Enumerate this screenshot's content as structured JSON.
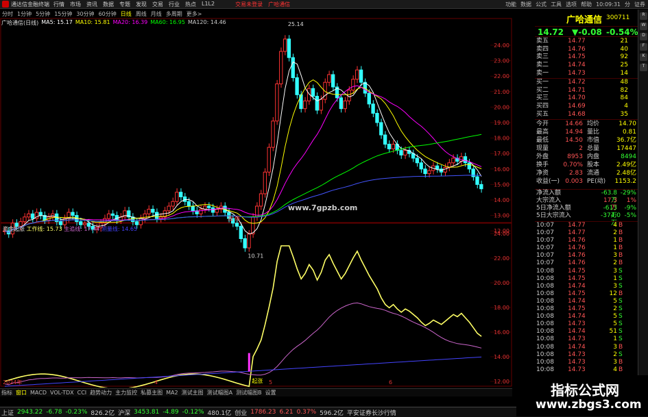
{
  "window": {
    "app_title": "通达信金融终端",
    "menu": [
      "行情",
      "市场",
      "资讯",
      "数据",
      "专题",
      "发现",
      "交易",
      "行业",
      "热点",
      "L1L2"
    ],
    "center": [
      "交易未登录",
      "广哈通信"
    ],
    "right": [
      "功能",
      "数据",
      "公式",
      "工具",
      "选项",
      "帮助",
      "10:09:31",
      "分",
      "证券"
    ]
  },
  "toolbar": {
    "items": [
      "分时",
      "1分钟",
      "5分钟",
      "15分钟",
      "30分钟",
      "60分钟",
      "日线",
      "周线",
      "月线",
      "多周期",
      "更多>"
    ],
    "active_index": 6
  },
  "main_legend": {
    "name": "广哈通信(日线)",
    "ma": [
      {
        "label": "MA5: 15.17",
        "color": "#ffffff"
      },
      {
        "label": "MA10: 15.81",
        "color": "#ffff00"
      },
      {
        "label": "MA20: 16.39",
        "color": "#ff00ff"
      },
      {
        "label": "MA60: 16.95",
        "color": "#00ff00"
      },
      {
        "label": "MA120: 14.46",
        "color": "#cccccc"
      }
    ]
  },
  "indicator_legend": {
    "name": "资金起涨",
    "items": [
      {
        "label": "工作线: 15.73",
        "color": "#ffff66"
      },
      {
        "label": "主追线: 17.44",
        "color": "#cc66cc"
      },
      {
        "label": "测量线: 14.65",
        "color": "#4444ff"
      }
    ]
  },
  "price_axis": [
    "24.00",
    "23.00",
    "22.00",
    "21.00",
    "20.00",
    "19.00",
    "18.00",
    "17.00",
    "16.00",
    "15.00",
    "14.00",
    "13.00",
    "12.00"
  ],
  "ind_axis": [
    "24.00",
    "22.00",
    "20.00",
    "18.00",
    "16.00",
    "14.00",
    "12.00"
  ],
  "annotations": {
    "high": "25.14",
    "low": "10.71",
    "watermark": "www.7gpzb.com",
    "signal": "起涨",
    "marks": [
      "涨",
      "停"
    ],
    "dates": [
      "2024年",
      "4",
      "5",
      "6"
    ]
  },
  "quote": {
    "name": "广哈通信",
    "code": "300711",
    "price": "14.72",
    "change": "▼-0.08",
    "pct": "-0.54%",
    "sell": [
      {
        "label": "卖五",
        "price": "14.77",
        "vol": "21"
      },
      {
        "label": "卖四",
        "price": "14.76",
        "vol": "40"
      },
      {
        "label": "卖三",
        "price": "14.75",
        "vol": "92"
      },
      {
        "label": "卖二",
        "price": "14.74",
        "vol": "25"
      },
      {
        "label": "卖一",
        "price": "14.73",
        "vol": "14"
      }
    ],
    "buy": [
      {
        "label": "买一",
        "price": "14.72",
        "vol": "48"
      },
      {
        "label": "买二",
        "price": "14.71",
        "vol": "82"
      },
      {
        "label": "买三",
        "price": "14.70",
        "vol": "84"
      },
      {
        "label": "买四",
        "price": "14.69",
        "vol": "4"
      },
      {
        "label": "买五",
        "price": "14.68",
        "vol": "35"
      }
    ],
    "stats": [
      {
        "l1": "今开",
        "v1": "14.66",
        "l2": "均价",
        "v2": "14.70"
      },
      {
        "l1": "最高",
        "v1": "14.94",
        "l2": "量比",
        "v2": "0.81"
      },
      {
        "l1": "最低",
        "v1": "14.50",
        "l2": "市值",
        "v2": "36.7亿"
      },
      {
        "l1": "现量",
        "v1": "2",
        "l2": "总量",
        "v2": "17447"
      },
      {
        "l1": "外盘",
        "v1": "8953",
        "l2": "内盘",
        "v2": "8494"
      },
      {
        "l1": "换手",
        "v1": "0.70%",
        "l2": "股本",
        "v2": "2.49亿"
      },
      {
        "l1": "净资",
        "v1": "2.83",
        "l2": "流通",
        "v2": "2.48亿"
      },
      {
        "l1": "收益(一)",
        "v1": "0.003",
        "l2": "PE(动)",
        "v2": "1153.2"
      }
    ],
    "flow": [
      {
        "l": "净流入额",
        "v": "-63.8万",
        "p": "-29%",
        "c": "#3f3"
      },
      {
        "l": "大宗流入",
        "v": "17.3万",
        "p": "1%",
        "c": "#f55"
      },
      {
        "l": "5日净流入额",
        "v": "-613万",
        "p": "-9%",
        "c": "#3f3"
      },
      {
        "l": "5日大宗流入",
        "v": "-374.0万",
        "p": "-5%",
        "c": "#3f3"
      }
    ],
    "trades": [
      {
        "t": "10:07",
        "p": "14.77",
        "v": "4",
        "s": "B"
      },
      {
        "t": "10:07",
        "p": "14.77",
        "v": "2",
        "s": "B"
      },
      {
        "t": "10:07",
        "p": "14.76",
        "v": "1",
        "s": "B"
      },
      {
        "t": "10:07",
        "p": "14.76",
        "v": "1",
        "s": "B"
      },
      {
        "t": "10:07",
        "p": "14.76",
        "v": "3",
        "s": "B"
      },
      {
        "t": "10:07",
        "p": "14.76",
        "v": "2",
        "s": "B"
      },
      {
        "t": "10:08",
        "p": "14.75",
        "v": "3",
        "s": "S"
      },
      {
        "t": "10:08",
        "p": "14.75",
        "v": "1",
        "s": "S"
      },
      {
        "t": "10:08",
        "p": "14.74",
        "v": "3",
        "s": "S"
      },
      {
        "t": "10:08",
        "p": "14.75",
        "v": "12",
        "s": "B"
      },
      {
        "t": "10:08",
        "p": "14.74",
        "v": "5",
        "s": "S"
      },
      {
        "t": "10:08",
        "p": "14.75",
        "v": "2",
        "s": "S"
      },
      {
        "t": "10:08",
        "p": "14.74",
        "v": "5",
        "s": "S"
      },
      {
        "t": "10:08",
        "p": "14.73",
        "v": "5",
        "s": "S"
      },
      {
        "t": "10:08",
        "p": "14.74",
        "v": "51",
        "s": "S"
      },
      {
        "t": "10:08",
        "p": "14.73",
        "v": "1",
        "s": "S"
      },
      {
        "t": "10:08",
        "p": "14.74",
        "v": "3",
        "s": "B"
      },
      {
        "t": "10:08",
        "p": "14.73",
        "v": "2",
        "s": "S"
      },
      {
        "t": "10:08",
        "p": "14.73",
        "v": "3",
        "s": "B"
      },
      {
        "t": "10:08",
        "p": "14.73",
        "v": "4",
        "s": "B"
      }
    ]
  },
  "bottom_tabs": [
    "指标",
    "窗口",
    "MACD",
    "VOL-TDX",
    "CCI",
    "趋势动力",
    "主力监控",
    "私募主图",
    "MA2",
    "测试主图",
    "测试幅图A",
    "测试幅图B",
    "设置"
  ],
  "bottom_tabs_selected": 1,
  "status": [
    {
      "label": "上证",
      "c": "#ccc"
    },
    {
      "label": "2943.22",
      "c": "#3f3"
    },
    {
      "label": "-6.78",
      "c": "#3f3"
    },
    {
      "label": "-0.23%",
      "c": "#3f3"
    },
    {
      "label": "826.2亿",
      "c": "#ccc"
    },
    {
      "label": "沪深",
      "c": "#ccc"
    },
    {
      "label": "3453.81",
      "c": "#3f3"
    },
    {
      "label": "-4.89",
      "c": "#3f3"
    },
    {
      "label": "-0.12%",
      "c": "#3f3"
    },
    {
      "label": "480.1亿",
      "c": "#ccc"
    },
    {
      "label": "创业",
      "c": "#ccc"
    },
    {
      "label": "1786.23",
      "c": "#f55"
    },
    {
      "label": "6.21",
      "c": "#f55"
    },
    {
      "label": "0.37%",
      "c": "#f55"
    },
    {
      "label": "596.2亿",
      "c": "#ccc"
    },
    {
      "label": "平安证券长沙行情",
      "c": "#ccc"
    }
  ],
  "watermark2": {
    "line1": "指标公式网",
    "line2": "www.zbgs3.com"
  }
}
